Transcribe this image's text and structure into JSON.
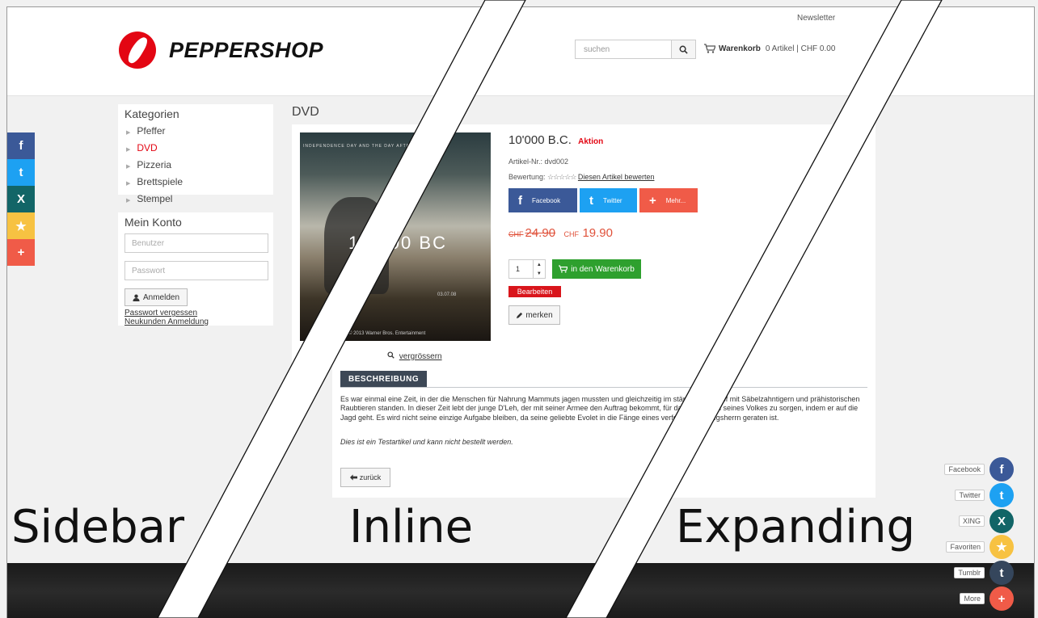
{
  "header": {
    "newsletter": "Newsletter",
    "logo_text": "PEPPERSHOP",
    "search_placeholder": "suchen",
    "cart_label": "Warenkorb",
    "cart_summary": "0 Artikel | CHF 0.00"
  },
  "share_sidebar": [
    {
      "icon": "facebook-icon",
      "glyph": "f",
      "color": "#3b5998"
    },
    {
      "icon": "twitter-icon",
      "glyph": "t",
      "color": "#1da1f2"
    },
    {
      "icon": "xing-icon",
      "glyph": "X",
      "color": "#126567"
    },
    {
      "icon": "star-icon",
      "glyph": "★",
      "color": "#f7c242"
    },
    {
      "icon": "plus-icon",
      "glyph": "+",
      "color": "#f05b48"
    }
  ],
  "categories": {
    "title": "Kategorien",
    "items": [
      "Pfeffer",
      "DVD",
      "Pizzeria",
      "Brettspiele",
      "Stempel"
    ],
    "active": "DVD"
  },
  "account": {
    "title": "Mein Konto",
    "user_placeholder": "Benutzer",
    "pass_placeholder": "Passwort",
    "login_label": "Anmelden",
    "forgot_link": "Passwort vergessen",
    "register_link": "Neukunden Anmeldung"
  },
  "main": {
    "section_title": "DVD",
    "zoom_label": "vergrössern",
    "poster_title": "10,000 BC",
    "poster_date": "03.07.08",
    "poster_copy": "© 2013 Warner Bros. Entertainment"
  },
  "product": {
    "title": "10'000 B.C.",
    "badge": "Aktion",
    "article_number": "Artikel-Nr.: dvd002",
    "rating_label": "Bewertung:",
    "rating_stars": "☆☆☆☆☆",
    "rating_link": "Diesen Artikel bewerten",
    "share": [
      {
        "label": "Facebook",
        "glyph": "f",
        "color": "#3b5998",
        "width": 85
      },
      {
        "label": "Twitter",
        "glyph": "t",
        "color": "#1da1f2",
        "width": 71
      },
      {
        "label": "Mehr...",
        "glyph": "+",
        "color": "#f05b48",
        "width": 72
      }
    ],
    "currency": "CHF",
    "old_price": "24.90",
    "new_price": "19.90",
    "quantity": "1",
    "cart_button": "in den Warenkorb",
    "edit_button": "Bearbeiten",
    "remember_button": "merken"
  },
  "description": {
    "tab_label": "BESCHREIBUNG",
    "text": "Es war einmal eine Zeit, in der die Menschen für Nahrung Mammuts jagen mussten und gleichzeitig im ständigen Kampf mit Säbelzahntigern und prähistorischen Raubtieren standen. In dieser Zeit lebt der junge D'Leh, der mit seiner Armee den Auftrag bekommt, für das Überleben seines Volkes zu sorgen, indem er auf die Jagd geht. Es wird nicht seine einzige Aufgabe bleiben, da seine geliebte Evolet in die Fänge eines verfeindeten Kriegsherrn geraten ist.",
    "note": "Dies ist ein Testartikel und kann nicht bestellt werden.",
    "back_button": "zurück"
  },
  "overlay_labels": {
    "sidebar": "Sidebar",
    "inline": "Inline",
    "expanding": "Expanding"
  },
  "expanding_share": [
    {
      "label": "Facebook",
      "glyph": "f",
      "color": "#3b5998"
    },
    {
      "label": "Twitter",
      "glyph": "t",
      "color": "#1da1f2"
    },
    {
      "label": "XING",
      "glyph": "X",
      "color": "#126567"
    },
    {
      "label": "Favoriten",
      "glyph": "★",
      "color": "#f7c242"
    },
    {
      "label": "Tumblr",
      "glyph": "t",
      "color": "#35465c"
    },
    {
      "label": "More",
      "glyph": "+",
      "color": "#f05b48"
    }
  ]
}
